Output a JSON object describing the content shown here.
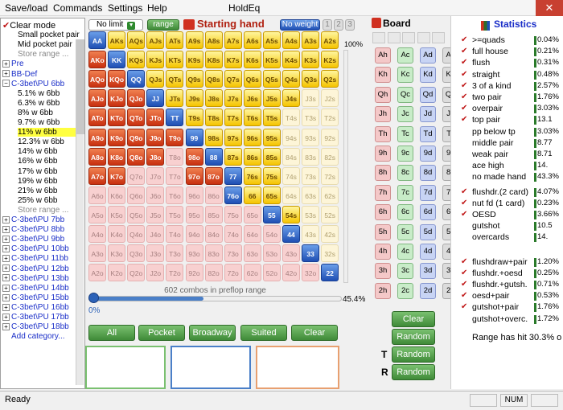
{
  "menu": {
    "items": [
      "Save/load",
      "Commands",
      "Settings",
      "Help"
    ],
    "title": "HoldEq"
  },
  "sidebar": {
    "clear_mode": "Clear mode",
    "items": [
      "Small pocket pair",
      "Mid pocket pair",
      "Store range ..."
    ],
    "groups": [
      "Pre",
      "BB-Def",
      "C-3bet\\PU 6bb"
    ],
    "ranges": [
      "5.1% w 6bb",
      "6.3% w 6bb",
      "8% w 6bb",
      "9.7% w 6bb",
      "11% w 6bb",
      "12.3% w 6bb",
      "14% w 6bb",
      "16% w 6bb",
      "17% w 6bb",
      "19% w 6bb",
      "21% w 6bb",
      "25% w 6bb",
      "Store range ..."
    ],
    "more_groups": [
      "C-3bet\\PU 7bb",
      "C-3bet\\PU 8bb",
      "C-3bet\\PU 9bb",
      "C-3bet\\PU 10bb",
      "C-3bet\\PU 11bb",
      "C-3bet\\PU 12bb",
      "C-3bet\\PU 13bb",
      "C-3bet\\PU 14bb",
      "C-3bet\\PU 15bb",
      "C-3bet\\PU 16bb",
      "C-3bet\\PU 17bb",
      "C-3bet\\PU 18bb"
    ],
    "add_category": "Add category..."
  },
  "range_controls": {
    "limit": "No limit",
    "range_btn": "range",
    "title": "Starting hand",
    "weight": "No weight",
    "pages": [
      "1",
      "2",
      "3"
    ],
    "top_pct": "100%",
    "bottom_pct": "0%",
    "slider_pct": "45.4%",
    "combos": "602 combos in preflop range"
  },
  "grid": {
    "ranks": [
      "A",
      "K",
      "Q",
      "J",
      "T",
      "9",
      "8",
      "7",
      "6",
      "5",
      "4",
      "3",
      "2"
    ],
    "colors": [
      "byyyyyyyyyyyy",
      "rbyyyyyyyyyyy",
      "rrbyyyyyyyyyy",
      "rrrbyyyyyyyqq",
      "rrrrbyyyyyqqq",
      "rrrrrbyyyyqqq",
      "rrrrprbyyyqqq",
      "rrppprrbyyqqq",
      "pppppppbyyqqq",
      "pppppppppbyqq",
      "ppppppppppbqq",
      "pppppppppppbq",
      "ppppppppppppb"
    ]
  },
  "buttons": {
    "all": "All",
    "pocket": "Pocket",
    "broadway": "Broadway",
    "suited": "Suited",
    "clear": "Clear"
  },
  "board": {
    "title": "Board",
    "ranks": [
      "A",
      "K",
      "Q",
      "J",
      "T",
      "9",
      "8",
      "7",
      "6",
      "5",
      "4",
      "3",
      "2"
    ],
    "suits": [
      "h",
      "c",
      "d",
      "s"
    ],
    "clear": "Clear",
    "random": "Random",
    "t_label": "T",
    "r_label": "R"
  },
  "stats": {
    "title": "Statistics",
    "rows": [
      {
        "label": ">=quads",
        "pct": "0.04%",
        "chk": true
      },
      {
        "label": "full house",
        "pct": "0.21%",
        "chk": true
      },
      {
        "label": "flush",
        "pct": "0.31%",
        "chk": true
      },
      {
        "label": "straight",
        "pct": "0.48%",
        "chk": true
      },
      {
        "label": "3 of a kind",
        "pct": "2.57%",
        "chk": true
      },
      {
        "label": "two pair",
        "pct": "1.76%",
        "chk": true
      },
      {
        "label": "overpair",
        "pct": "3.03%",
        "chk": true
      },
      {
        "label": "top pair",
        "pct": "13.1",
        "chk": true
      },
      {
        "label": "pp below tp",
        "pct": "3.03%",
        "chk": false
      },
      {
        "label": "middle pair",
        "pct": "8.77",
        "chk": false
      },
      {
        "label": "weak pair",
        "pct": "8.71",
        "chk": false
      },
      {
        "label": "ace high",
        "pct": "14.",
        "chk": false
      },
      {
        "label": "no made hand",
        "pct": "43.3%",
        "chk": false
      },
      {
        "label": "flushdr.(2 card)",
        "pct": "4.07%",
        "chk": true
      },
      {
        "label": "nut fd (1 card)",
        "pct": "0.23%",
        "chk": true
      },
      {
        "label": "OESD",
        "pct": "3.66%",
        "chk": true
      },
      {
        "label": "gutshot",
        "pct": "10.5",
        "chk": false
      },
      {
        "label": "overcards",
        "pct": "14.",
        "chk": false
      },
      {
        "label": "flushdraw+pair",
        "pct": "1.20%",
        "chk": true
      },
      {
        "label": "flushdr.+oesd",
        "pct": "0.25%",
        "chk": true
      },
      {
        "label": "flushdr.+gutsh.",
        "pct": "0.71%",
        "chk": true
      },
      {
        "label": "oesd+pair",
        "pct": "0.53%",
        "chk": true
      },
      {
        "label": "gutshot+pair",
        "pct": "1.76%",
        "chk": true
      },
      {
        "label": "gutshot+overc.",
        "pct": "1.72%",
        "chk": false
      }
    ],
    "range_hit": "Range has hit 30.3% o"
  },
  "status": {
    "text": "Ready",
    "num": "NUM"
  }
}
